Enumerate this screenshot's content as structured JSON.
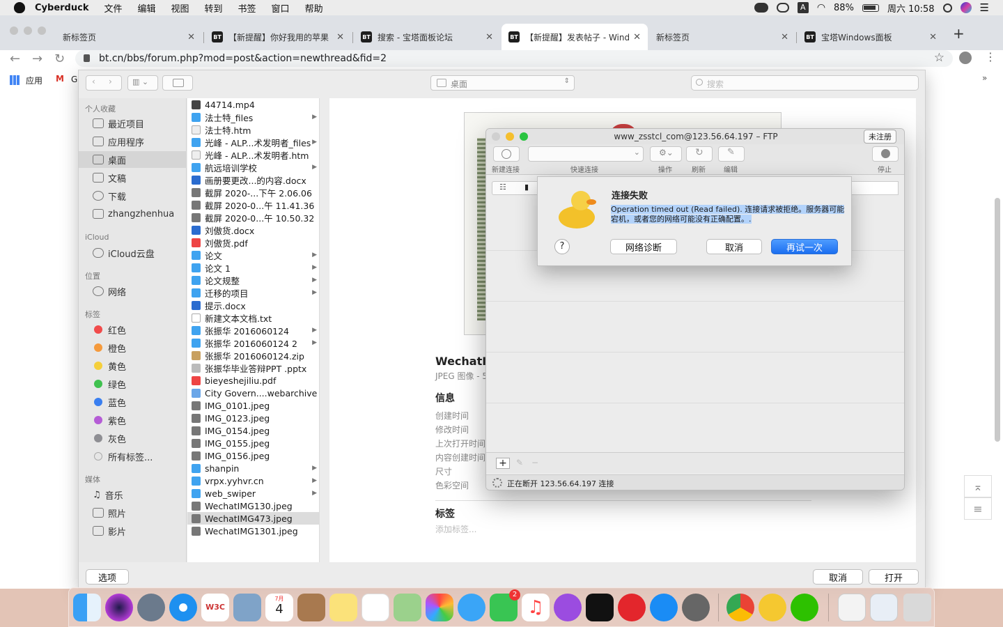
{
  "menubar": {
    "app": "Cyberduck",
    "items": [
      "文件",
      "编辑",
      "视图",
      "转到",
      "书签",
      "窗口",
      "帮助"
    ],
    "battery": "88%",
    "clock": "周六 10:58"
  },
  "browser": {
    "tabs": [
      {
        "title": "新标签页"
      },
      {
        "title": "【新提醒】你好我用的苹果"
      },
      {
        "title": "搜索 - 宝塔面板论坛"
      },
      {
        "title": "【新提醒】发表帖子 - Windo"
      },
      {
        "title": "新标签页"
      },
      {
        "title": "宝塔Windows面板"
      }
    ],
    "favicon_text": "BT",
    "url": "bt.cn/bbs/forum.php?mod=post&action=newthread&fid=2",
    "bookmarks": {
      "apps": "应用",
      "g": "G"
    }
  },
  "finder": {
    "location": "桌面",
    "search_placeholder": "搜索",
    "sidebar": {
      "favorites_header": "个人收藏",
      "favorites": [
        "最近项目",
        "应用程序",
        "桌面",
        "文稿",
        "下载",
        "zhangzhenhua"
      ],
      "icloud_header": "iCloud",
      "icloud": [
        "iCloud云盘"
      ],
      "locations_header": "位置",
      "locations": [
        "网络"
      ],
      "tags_header": "标签",
      "tags": [
        {
          "label": "红色",
          "color": "#f14b4b"
        },
        {
          "label": "橙色",
          "color": "#f59a3c"
        },
        {
          "label": "黄色",
          "color": "#f5cf3b"
        },
        {
          "label": "绿色",
          "color": "#3fc14f"
        },
        {
          "label": "蓝色",
          "color": "#3a7ff0"
        },
        {
          "label": "紫色",
          "color": "#b55cd6"
        },
        {
          "label": "灰色",
          "color": "#8e8e93"
        },
        {
          "label": "所有标签...",
          "color": "#e6e6e6"
        }
      ],
      "media_header": "媒体",
      "media": [
        "音乐",
        "照片",
        "影片"
      ]
    },
    "files": [
      {
        "name": "44714.mp4",
        "kind": "video"
      },
      {
        "name": "法士特_files",
        "kind": "folder"
      },
      {
        "name": "法士特.htm",
        "kind": "html"
      },
      {
        "name": "光峰 - ALP...术发明者_files",
        "kind": "folder"
      },
      {
        "name": "光峰 - ALP...术发明者.htm",
        "kind": "html"
      },
      {
        "name": "航远培训学校",
        "kind": "folder"
      },
      {
        "name": "画册要更改...的内容.docx",
        "kind": "doc"
      },
      {
        "name": "截屏 2020-...下午 2.06.06",
        "kind": "img"
      },
      {
        "name": "截屏 2020-0...午 11.41.36",
        "kind": "img"
      },
      {
        "name": "截屏 2020-0...午 10.50.32",
        "kind": "img"
      },
      {
        "name": "刘傲货.docx",
        "kind": "doc"
      },
      {
        "name": "刘傲货.pdf",
        "kind": "pdf"
      },
      {
        "name": "论文",
        "kind": "folder"
      },
      {
        "name": "论文 1",
        "kind": "folder"
      },
      {
        "name": "论文规整",
        "kind": "folder"
      },
      {
        "name": "迁移的项目",
        "kind": "folder"
      },
      {
        "name": "提示.docx",
        "kind": "doc"
      },
      {
        "name": "新建文本文档.txt",
        "kind": "txt"
      },
      {
        "name": "张振华 2016060124",
        "kind": "folder"
      },
      {
        "name": "张振华 2016060124 2",
        "kind": "folder"
      },
      {
        "name": "张振华 2016060124.zip",
        "kind": "zip"
      },
      {
        "name": "张振华毕业答辩PPT .pptx",
        "kind": "ppt"
      },
      {
        "name": "bieyeshejiliu.pdf",
        "kind": "pdf"
      },
      {
        "name": "City Govern....webarchive",
        "kind": "web"
      },
      {
        "name": "IMG_0101.jpeg",
        "kind": "img"
      },
      {
        "name": "IMG_0123.jpeg",
        "kind": "img"
      },
      {
        "name": "IMG_0154.jpeg",
        "kind": "img"
      },
      {
        "name": "IMG_0155.jpeg",
        "kind": "img"
      },
      {
        "name": "IMG_0156.jpeg",
        "kind": "img"
      },
      {
        "name": "shanpin",
        "kind": "folder"
      },
      {
        "name": "vrpx.yyhvr.cn",
        "kind": "folder"
      },
      {
        "name": "web_swiper",
        "kind": "folder"
      },
      {
        "name": "WechatIMG130.jpeg",
        "kind": "img"
      },
      {
        "name": "WechatIMG473.jpeg",
        "kind": "img"
      },
      {
        "name": "WechatIMG1301.jpeg",
        "kind": "img"
      }
    ],
    "preview": {
      "filename": "WechatIMG",
      "subtitle": "JPEG 图像 - 5",
      "info_header": "信息",
      "info_labels": [
        "创建时间",
        "修改时间",
        "上次打开时间",
        "内容创建时间",
        "尺寸",
        "色彩空间"
      ],
      "tags_header": "标签",
      "tags_placeholder": "添加标签..."
    },
    "buttons": {
      "options": "选项",
      "cancel": "取消",
      "open": "打开"
    }
  },
  "ftp": {
    "title": "www_zsstcl_com@123.56.64.197 – FTP",
    "unregistered": "未注册",
    "toolbar": {
      "new_connection": "新建连接",
      "quick_connect": "快速连接",
      "action": "操作",
      "refresh": "刷新",
      "edit": "编辑",
      "stop": "停止"
    },
    "status": "正在断开 123.56.64.197 连接"
  },
  "alert": {
    "title": "连接失败",
    "message": "Operation timed out (Read failed). 连接请求被拒绝。服务器可能宕机，或者您的网络可能没有正确配置。.",
    "help": "?",
    "btn_diagnose": "网络诊断",
    "btn_cancel": "取消",
    "btn_retry": "再试一次"
  },
  "dock": {
    "calendar_month": "7月",
    "calendar_day": "4",
    "facetime_badge": "2"
  }
}
